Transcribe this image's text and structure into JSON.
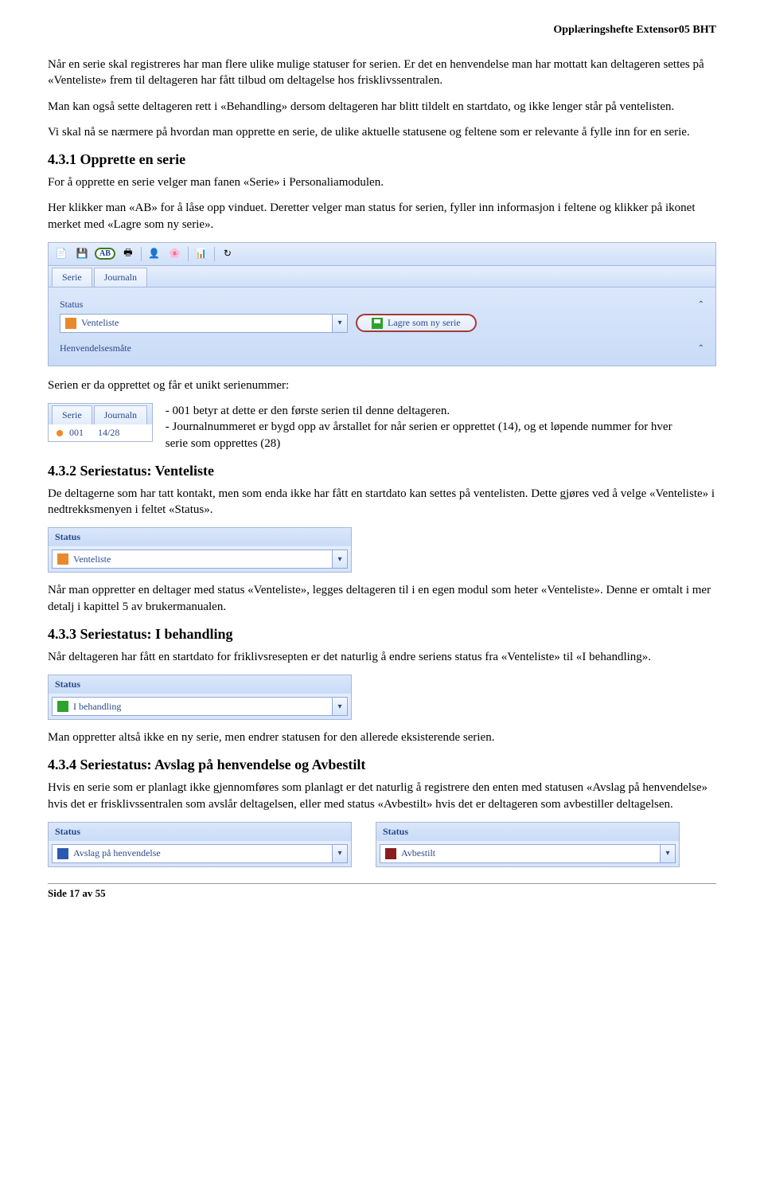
{
  "header": {
    "right": "Opplæringshefte Extensor05 BHT"
  },
  "intro": {
    "p1": "Når en serie skal registreres har man flere ulike mulige statuser for serien. Er det en henvendelse man har mottatt kan deltageren settes på «Venteliste» frem til deltageren har fått tilbud om deltagelse hos frisklivssentralen.",
    "p2": "Man kan også sette deltageren rett i «Behandling» dersom deltageren har blitt tildelt en startdato, og ikke lenger står på ventelisten.",
    "p3": "Vi skal nå se nærmere på hvordan man opprette en serie, de ulike aktuelle statusene og feltene som er relevante å fylle inn for en serie."
  },
  "s431": {
    "heading": "4.3.1  Opprette en serie",
    "p1": "For å opprette en serie velger man fanen «Serie» i Personaliamodulen.",
    "p2": "Her klikker man «AB» for å låse opp vinduet. Deretter velger man status for serien, fyller inn informasjon i feltene og klikker på ikonet merket med «Lagre som ny serie».",
    "fig": {
      "ab": "AB",
      "tab_serie": "Serie",
      "tab_journal": "Journaln",
      "status_label": "Status",
      "status_value": "Venteliste",
      "save_label": "Lagre som ny serie",
      "henv_label": "Henvendelsesmåte"
    },
    "after": "Serien er da opprettet og får et unikt serienummer:",
    "mini": {
      "tab_serie": "Serie",
      "tab_journal": "Journaln",
      "serie_val": "001",
      "journal_val": "14/28"
    },
    "bullets": {
      "b1": "- 001 betyr at dette er den første serien til denne deltageren.",
      "b2": "- Journalnummeret er bygd opp av årstallet for når serien er opprettet (14), og et løpende nummer for hver serie som opprettes (28)"
    }
  },
  "s432": {
    "heading": "4.3.2  Seriestatus: Venteliste",
    "p1": "De deltagerne som har tatt kontakt, men som enda ikke har fått en startdato kan settes på ventelisten. Dette gjøres ved å velge «Venteliste» i nedtrekksmenyen i feltet «Status».",
    "status_label": "Status",
    "status_value": "Venteliste",
    "p2": "Når man oppretter en deltager med status «Venteliste», legges deltageren til i en egen modul som heter «Venteliste». Denne er omtalt i mer detalj i kapittel 5 av brukermanualen."
  },
  "s433": {
    "heading": "4.3.3  Seriestatus: I behandling",
    "p1": "Når deltageren har fått en startdato for friklivsresepten er det naturlig å endre seriens status fra «Venteliste» til «I behandling».",
    "status_label": "Status",
    "status_value": "I behandling",
    "p2": "Man oppretter altså ikke en ny serie, men endrer statusen for den allerede eksisterende serien."
  },
  "s434": {
    "heading": "4.3.4  Seriestatus: Avslag på henvendelse og Avbestilt",
    "p1": "Hvis en serie som er planlagt ikke gjennomføres som planlagt er det naturlig å registrere den enten med statusen «Avslag på henvendelse» hvis det er frisklivssentralen som avslår deltagelsen, eller med status «Avbestilt» hvis det er deltageren som avbestiller deltagelsen.",
    "left": {
      "status_label": "Status",
      "status_value": "Avslag på henvendelse"
    },
    "right": {
      "status_label": "Status",
      "status_value": "Avbestilt"
    }
  },
  "footer": "Side 17 av 55"
}
